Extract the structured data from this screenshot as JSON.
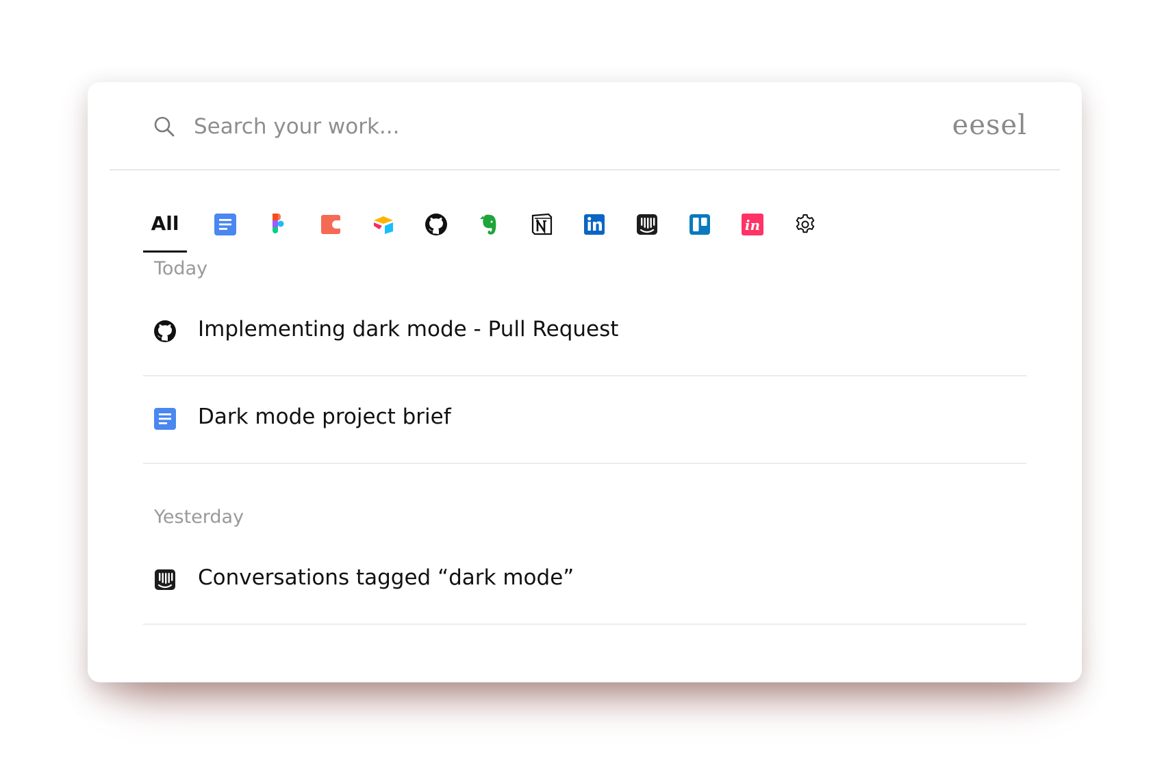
{
  "search": {
    "placeholder": "Search your work..."
  },
  "brand": "eesel",
  "filters": {
    "all_label": "All",
    "icons": [
      "google-docs",
      "figma",
      "coda",
      "airtable",
      "github",
      "evernote",
      "notion",
      "linkedin",
      "intercom",
      "trello",
      "invision",
      "settings"
    ]
  },
  "sections": [
    {
      "label": "Today",
      "items": [
        {
          "icon": "github",
          "title": "Implementing dark mode - Pull Request"
        },
        {
          "icon": "google-docs",
          "title": "Dark mode project brief"
        }
      ]
    },
    {
      "label": "Yesterday",
      "items": [
        {
          "icon": "intercom",
          "title": "Conversations tagged “dark mode”"
        }
      ]
    }
  ],
  "colors": {
    "shadow": "#8c504b",
    "docs_blue": "#4a87f0",
    "coda_red": "#f46a54",
    "evernote_green": "#1fa53a",
    "linkedin_blue": "#0a66c2",
    "trello_blue": "#0a79bf",
    "invision_pink": "#ff3366"
  }
}
